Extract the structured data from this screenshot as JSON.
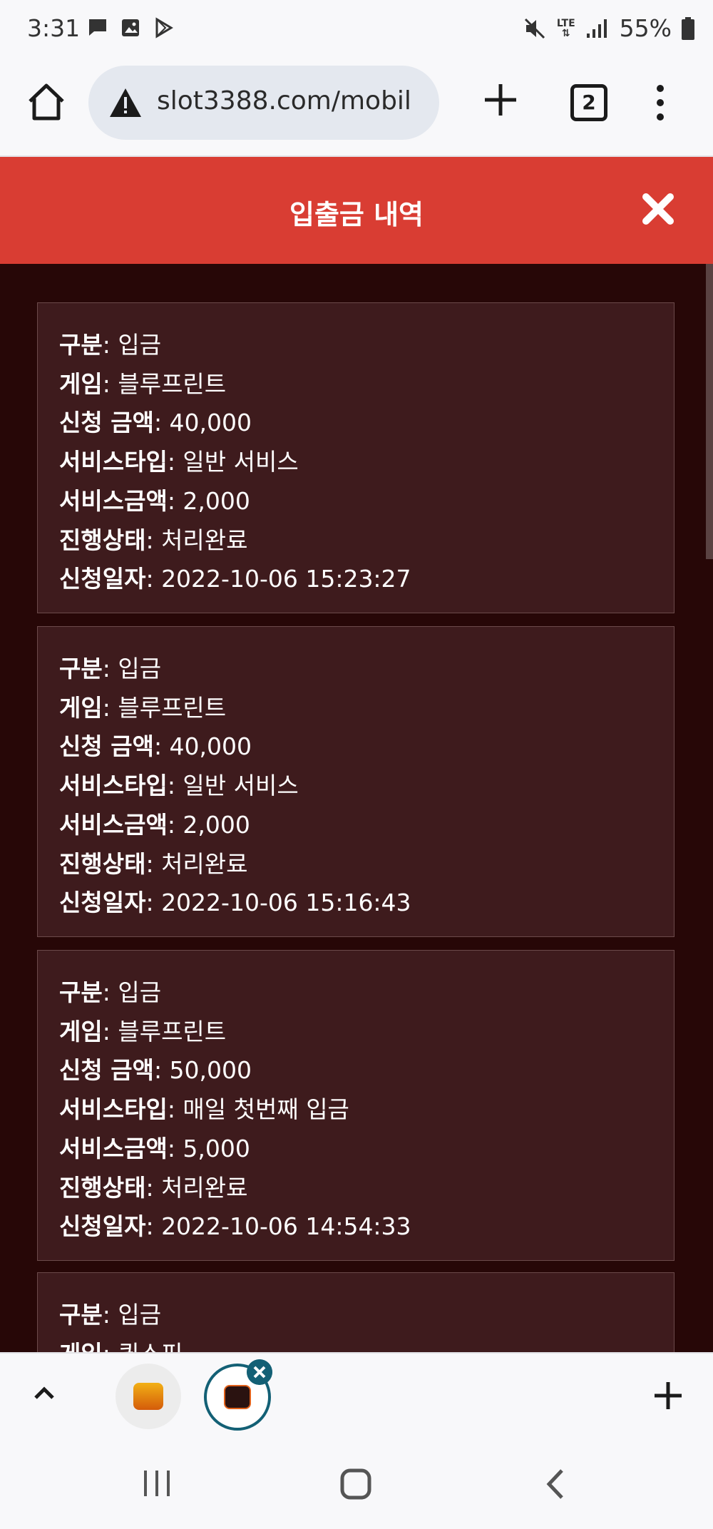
{
  "status_bar": {
    "time": "3:31",
    "battery": "55%",
    "network": "LTE"
  },
  "browser": {
    "url": "slot3388.com/mobil",
    "tab_count": "2"
  },
  "page": {
    "title": "입출금 내역"
  },
  "labels": {
    "type": "구분",
    "game": "게임",
    "amount": "신청 금액",
    "service_type": "서비스타입",
    "service_amount": "서비스금액",
    "status": "진행상태",
    "date": "신청일자"
  },
  "records": [
    {
      "type": "입금",
      "game": "블루프린트",
      "amount": "40,000",
      "service_type": "일반 서비스",
      "service_amount": "2,000",
      "status": "처리완료",
      "date": "2022-10-06 15:23:27"
    },
    {
      "type": "입금",
      "game": "블루프린트",
      "amount": "40,000",
      "service_type": "일반 서비스",
      "service_amount": "2,000",
      "status": "처리완료",
      "date": "2022-10-06 15:16:43"
    },
    {
      "type": "입금",
      "game": "블루프린트",
      "amount": "50,000",
      "service_type": "매일 첫번째 입금",
      "service_amount": "5,000",
      "status": "처리완료",
      "date": "2022-10-06 14:54:33"
    },
    {
      "type": "입금",
      "game": "퀵스핀"
    }
  ],
  "colors": {
    "header": "#d93d33",
    "content_bg": "#270707",
    "card_bg": "#3e1b1d",
    "tab_accent": "#136075"
  }
}
